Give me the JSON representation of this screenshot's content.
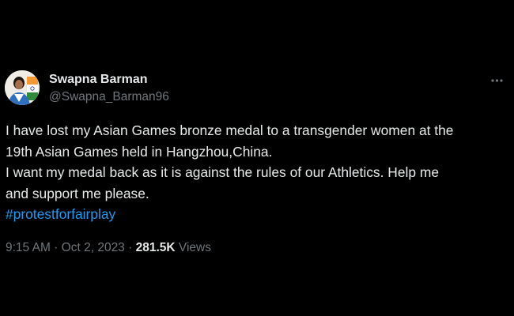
{
  "author": {
    "display_name": "Swapna Barman",
    "handle": "@Swapna_Barman96",
    "avatar": "profile-photo-with-indian-flag"
  },
  "menu_icon": "more-horizontal-icon",
  "tweet": {
    "lines": [
      "I have lost my Asian Games bronze medal to a transgender women at the",
      "19th Asian Games held in Hangzhou,China.",
      "I want my medal back as it is against the rules of our Athletics. Help me",
      "and support me please."
    ],
    "hashtag": "#protestforfairplay"
  },
  "meta": {
    "time": "9:15 AM",
    "separator": "·",
    "date": "Oct 2, 2023",
    "views_count": "281.5K",
    "views_label": "Views"
  },
  "colors": {
    "background": "#000000",
    "text": "#e7e9ea",
    "secondary": "#71767b",
    "link": "#1d9bf0"
  }
}
